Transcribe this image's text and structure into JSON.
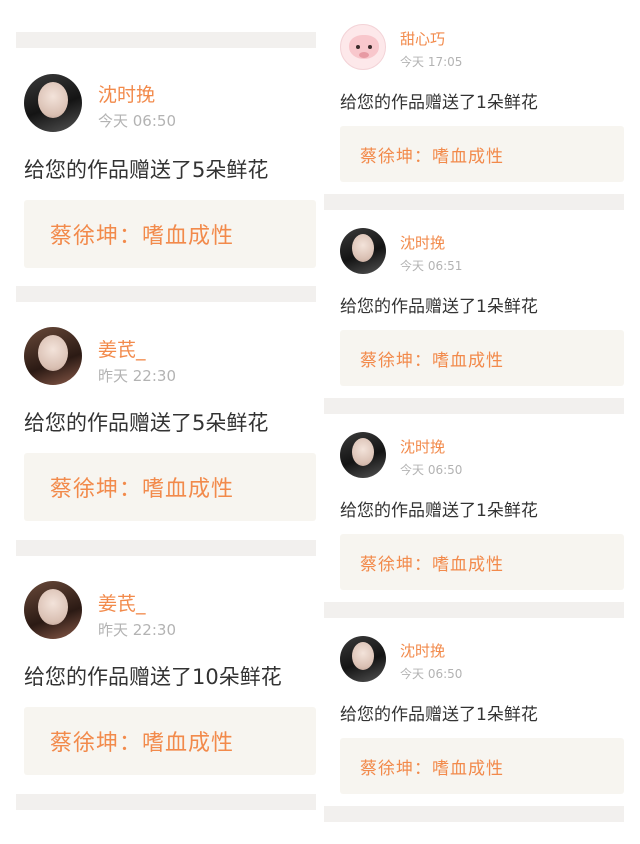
{
  "left": [
    {
      "name": "沈时挽",
      "time": "今天 06:50",
      "message": "给您的作品赠送了5朵鲜花",
      "work": "蔡徐坤：嗜血成性",
      "avatar": "profile-photo"
    },
    {
      "name": "姜芪_",
      "time": "昨天 22:30",
      "message": "给您的作品赠送了5朵鲜花",
      "work": "蔡徐坤：嗜血成性",
      "avatar": "profile-photo"
    },
    {
      "name": "姜芪_",
      "time": "昨天 22:30",
      "message": "给您的作品赠送了10朵鲜花",
      "work": "蔡徐坤：嗜血成性",
      "avatar": "profile-photo"
    }
  ],
  "right": [
    {
      "name": "甜心巧",
      "time": "今天 17:05",
      "message": "给您的作品赠送了1朵鲜花",
      "work": "蔡徐坤：嗜血成性",
      "avatar": "cartoon-cat"
    },
    {
      "name": "沈时挽",
      "time": "今天 06:51",
      "message": "给您的作品赠送了1朵鲜花",
      "work": "蔡徐坤：嗜血成性",
      "avatar": "profile-photo"
    },
    {
      "name": "沈时挽",
      "time": "今天 06:50",
      "message": "给您的作品赠送了1朵鲜花",
      "work": "蔡徐坤：嗜血成性",
      "avatar": "profile-photo"
    },
    {
      "name": "沈时挽",
      "time": "今天 06:50",
      "message": "给您的作品赠送了1朵鲜花",
      "work": "蔡徐坤：嗜血成性",
      "avatar": "profile-photo"
    }
  ],
  "colors": {
    "accent": "#f28a4b",
    "divider": "#f2f0ee",
    "card": "#f7f5f0",
    "muted": "#b3b3b3",
    "text": "#333333"
  }
}
